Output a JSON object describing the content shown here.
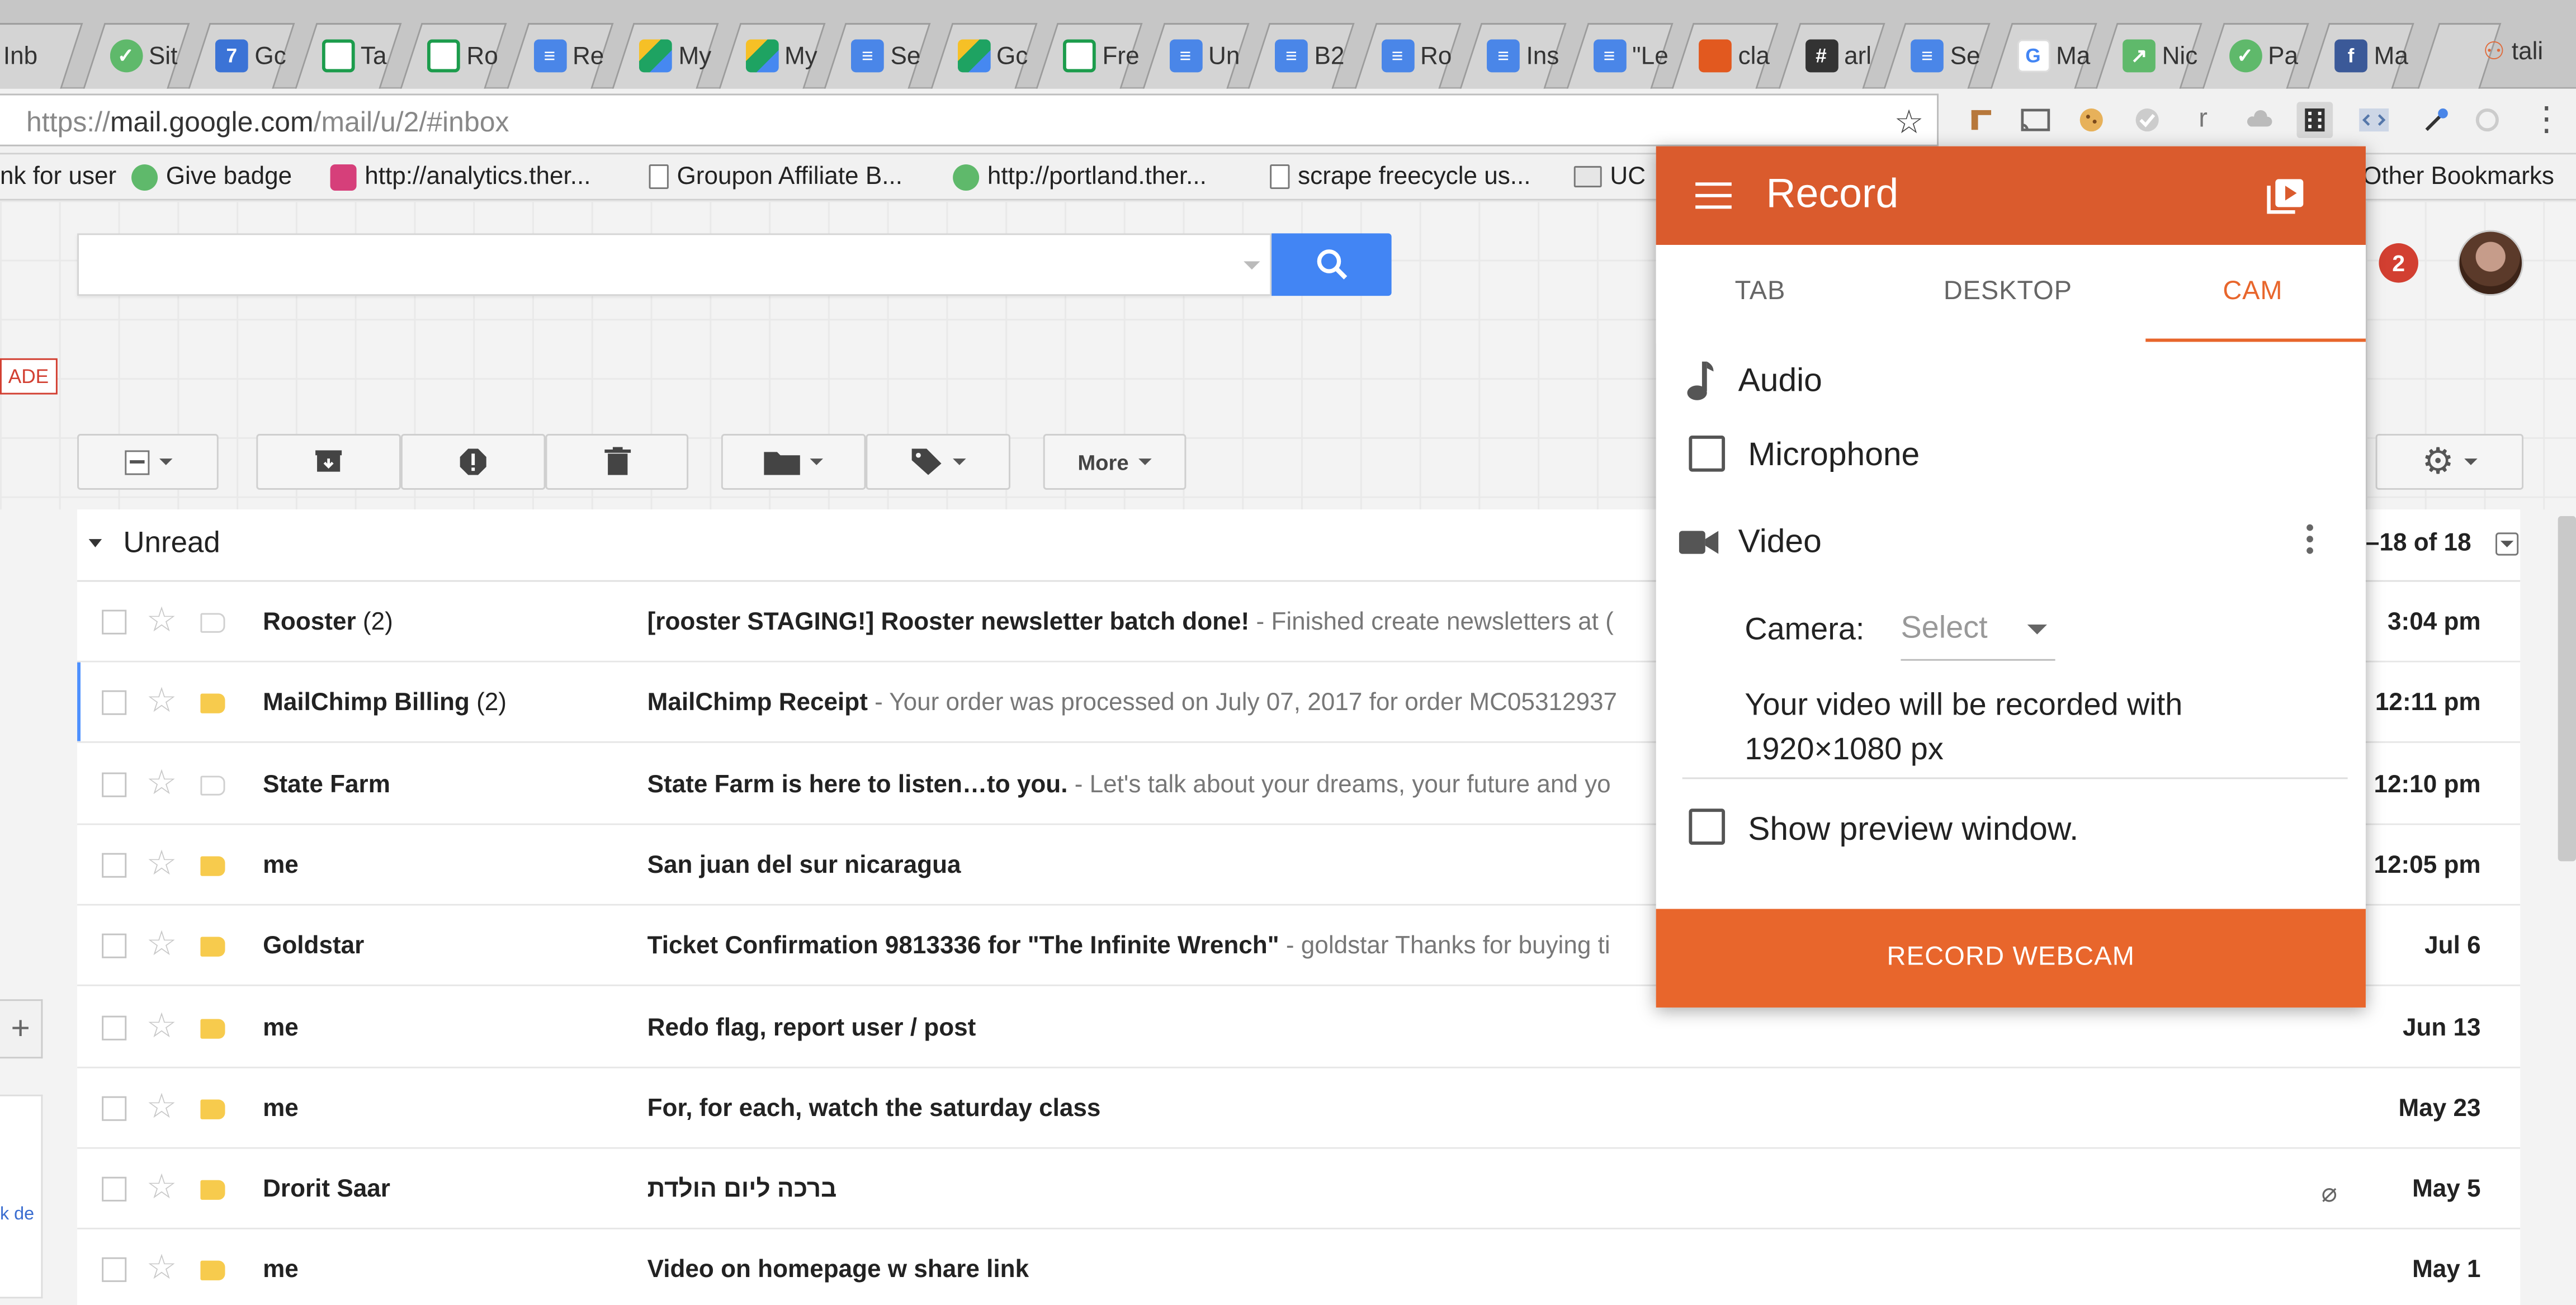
{
  "browser": {
    "tabs": [
      {
        "label": "Inb",
        "icon": "gmail-favicon"
      },
      {
        "label": "Sit",
        "icon": "green-circle-favicon"
      },
      {
        "label": "Gc",
        "icon": "calendar-favicon"
      },
      {
        "label": "Ta",
        "icon": "sheets-favicon"
      },
      {
        "label": "Ro",
        "icon": "sheets-favicon"
      },
      {
        "label": "Re",
        "icon": "docs-favicon"
      },
      {
        "label": "My",
        "icon": "drive-favicon"
      },
      {
        "label": "My",
        "icon": "drive-favicon"
      },
      {
        "label": "Se",
        "icon": "docs-favicon"
      },
      {
        "label": "Gc",
        "icon": "drive-favicon"
      },
      {
        "label": "Fre",
        "icon": "sheets-favicon"
      },
      {
        "label": "Un",
        "icon": "docs-favicon"
      },
      {
        "label": "B2",
        "icon": "docs-favicon"
      },
      {
        "label": "Ro",
        "icon": "docs-favicon"
      },
      {
        "label": "Ins",
        "icon": "docs-favicon"
      },
      {
        "label": "\"Le",
        "icon": "docs-favicon"
      },
      {
        "label": "cla",
        "icon": "gitlab-favicon"
      },
      {
        "label": "arl",
        "icon": "slack-favicon"
      },
      {
        "label": "Se",
        "icon": "docs-favicon"
      },
      {
        "label": "Ma",
        "icon": "google-favicon"
      },
      {
        "label": "Nic",
        "icon": "maps-favicon"
      },
      {
        "label": "Pa",
        "icon": "green-circle-favicon"
      },
      {
        "label": "Ma",
        "icon": "facebook-favicon"
      }
    ],
    "profile_name": "tali",
    "url_scheme": "https://",
    "url_domain": "mail.google.com",
    "url_path": "/mail/u/2/#inbox",
    "bookmarks": [
      {
        "label": "nk for user",
        "icon": "none"
      },
      {
        "label": "Give badge",
        "icon": "green-circle-favicon"
      },
      {
        "label": "http://analytics.ther...",
        "icon": "k-favicon"
      },
      {
        "label": "Groupon Affiliate B...",
        "icon": "page-icon"
      },
      {
        "label": "http://portland.ther...",
        "icon": "green-circle-favicon"
      },
      {
        "label": "scrape freecycle us...",
        "icon": "page-icon"
      },
      {
        "label": "UC",
        "icon": "folder-icon"
      },
      {
        "label": "Other Bookmarks",
        "icon": "folder-icon"
      }
    ]
  },
  "gmail": {
    "upgrade_badge": "ADE",
    "toolbar": {
      "more_label": "More"
    },
    "section_title": "Unread",
    "count_text": "–18 of 18",
    "notification_count": "2",
    "left_fragment": "k de",
    "emails": [
      {
        "sender": "Rooster",
        "count": "(2)",
        "subject": "[rooster STAGING!] Rooster newsletter batch done!",
        "snippet": " - Finished create newsletters at (",
        "date": "3:04 pm",
        "label_on": false,
        "attachment": false
      },
      {
        "sender": "MailChimp Billing",
        "count": "(2)",
        "subject": "MailChimp Receipt",
        "snippet": " - Your order was processed on July 07, 2017 for order MC05312937",
        "date": "12:11 pm",
        "label_on": true,
        "attachment": false
      },
      {
        "sender": "State Farm",
        "count": "",
        "subject": "State Farm is here to listen…to you.",
        "snippet": " - Let's talk about your dreams, your future and yo",
        "date": "12:10 pm",
        "label_on": false,
        "attachment": false
      },
      {
        "sender": "me",
        "count": "",
        "subject": "San juan del sur nicaragua",
        "snippet": "",
        "date": "12:05 pm",
        "label_on": true,
        "attachment": false
      },
      {
        "sender": "Goldstar",
        "count": "",
        "subject": "Ticket Confirmation 9813336 for \"The Infinite Wrench\"",
        "snippet": " - goldstar Thanks for buying ti",
        "date": "Jul 6",
        "label_on": true,
        "attachment": false
      },
      {
        "sender": "me",
        "count": "",
        "subject": "Redo flag, report user / post",
        "snippet": "",
        "date": "Jun 13",
        "label_on": true,
        "attachment": false
      },
      {
        "sender": "me",
        "count": "",
        "subject": "For, for each, watch the saturday class",
        "snippet": "",
        "date": "May 23",
        "label_on": true,
        "attachment": false
      },
      {
        "sender": "Drorit Saar",
        "count": "",
        "subject": "ברכה ליום הולדת",
        "snippet": "",
        "date": "May 5",
        "label_on": true,
        "attachment": true
      },
      {
        "sender": "me",
        "count": "",
        "subject": "Video on homepage w share link",
        "snippet": "",
        "date": "May 1",
        "label_on": true,
        "attachment": false
      }
    ]
  },
  "popup": {
    "title": "Record",
    "tabs": {
      "tab": "TAB",
      "desktop": "DESKTOP",
      "cam": "CAM"
    },
    "audio_label": "Audio",
    "microphone_label": "Microphone",
    "video_label": "Video",
    "camera_label": "Camera:",
    "camera_select": "Select",
    "info_text": "Your video will be recorded with 1920×1080 px",
    "preview_label": "Show preview window.",
    "record_button": "RECORD WEBCAM",
    "accent_color": "#e8662c"
  }
}
